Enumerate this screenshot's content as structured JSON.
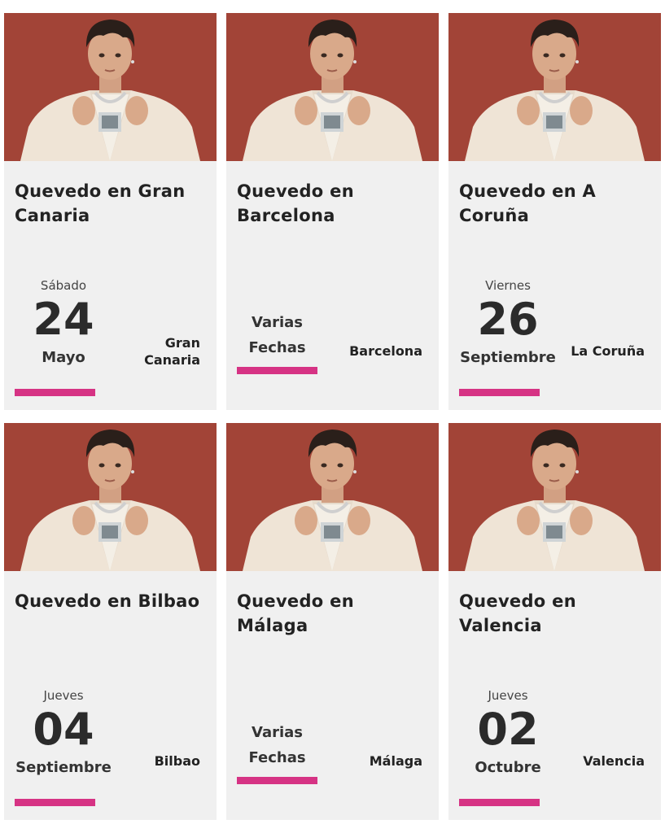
{
  "colors": {
    "card_bg": "#f0f0f0",
    "accent_underline": "#d63384",
    "photo_bg": "#a8473a"
  },
  "events": [
    {
      "title": "Quevedo en Gran Canaria",
      "weekday": "Sábado",
      "day": "24",
      "month": "Mayo",
      "city_line1": "Gran",
      "city_line2": "Canaria",
      "image": "artist-photo"
    },
    {
      "title": "Quevedo en Barcelona",
      "varias_line1": "Varias",
      "varias_line2": "Fechas",
      "city_line1": "Barcelona",
      "image": "artist-photo"
    },
    {
      "title": "Quevedo en A Coruña",
      "weekday": "Viernes",
      "day": "26",
      "month": "Septiembre",
      "city_line1": "La Coruña",
      "image": "artist-photo"
    },
    {
      "title": "Quevedo en Bilbao",
      "weekday": "Jueves",
      "day": "04",
      "month": "Septiembre",
      "city_line1": "Bilbao",
      "image": "artist-photo"
    },
    {
      "title": "Quevedo en Málaga",
      "varias_line1": "Varias",
      "varias_line2": "Fechas",
      "city_line1": "Málaga",
      "image": "artist-photo"
    },
    {
      "title": "Quevedo en Valencia",
      "weekday": "Jueves",
      "day": "02",
      "month": "Octubre",
      "city_line1": "Valencia",
      "image": "artist-photo"
    }
  ]
}
